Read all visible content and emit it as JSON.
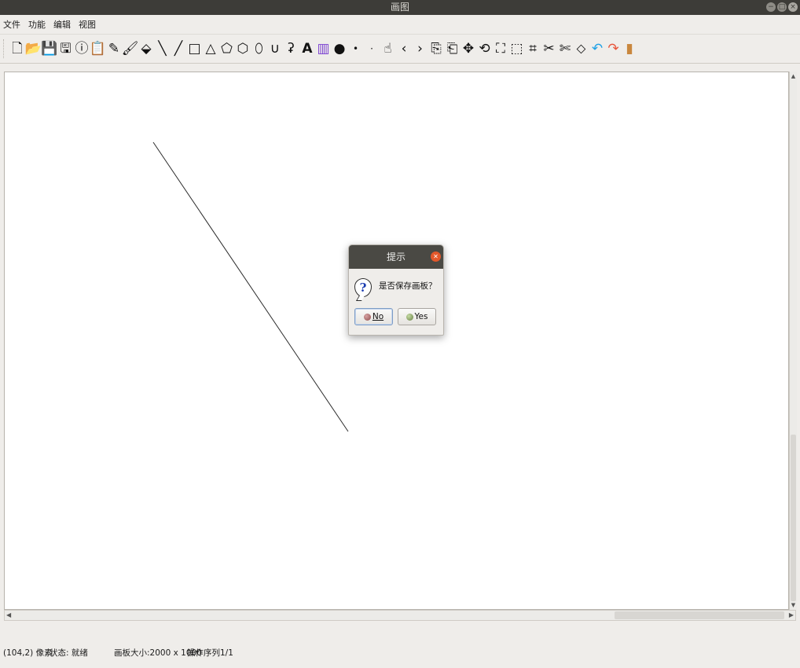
{
  "window": {
    "title": "画图",
    "controls": [
      "−",
      "□",
      "×"
    ]
  },
  "menu": [
    "文件",
    "功能",
    "编辑",
    "视图"
  ],
  "toolbar": {
    "tools": [
      {
        "name": "new-file-icon",
        "glyph": "🗋"
      },
      {
        "name": "open-folder-icon",
        "glyph": "📂"
      },
      {
        "name": "save-icon",
        "glyph": "💾"
      },
      {
        "name": "save-as-icon",
        "glyph": "🖫"
      },
      {
        "name": "info-icon",
        "glyph": "ⓘ"
      },
      {
        "name": "clipboard-icon",
        "glyph": "📋"
      },
      {
        "name": "pencil-icon",
        "glyph": "✎"
      },
      {
        "name": "brush-icon",
        "glyph": "🖌"
      },
      {
        "name": "eraser-icon",
        "glyph": "⬙"
      },
      {
        "name": "backslash-line-icon",
        "glyph": "╲"
      },
      {
        "name": "line-icon",
        "glyph": "╱"
      },
      {
        "name": "rectangle-icon",
        "glyph": "□"
      },
      {
        "name": "triangle-icon",
        "glyph": "△"
      },
      {
        "name": "pentagon-icon",
        "glyph": "⬠"
      },
      {
        "name": "polygon-icon",
        "glyph": "⬡"
      },
      {
        "name": "ellipse-icon",
        "glyph": "⬯"
      },
      {
        "name": "curve-icon",
        "glyph": "∪"
      },
      {
        "name": "freeform-icon",
        "glyph": "ʡ"
      },
      {
        "name": "text-icon",
        "glyph": "A"
      },
      {
        "name": "color-picker-icon",
        "glyph": "▥"
      },
      {
        "name": "brush-size-large-icon",
        "glyph": "●"
      },
      {
        "name": "brush-size-medium-icon",
        "glyph": "•"
      },
      {
        "name": "brush-size-small-icon",
        "glyph": "·"
      },
      {
        "name": "pointer-icon",
        "glyph": "☝"
      },
      {
        "name": "previous-icon",
        "glyph": "‹"
      },
      {
        "name": "next-icon",
        "glyph": "›"
      },
      {
        "name": "copy-icon",
        "glyph": "⎘"
      },
      {
        "name": "paste-icon",
        "glyph": "⎗"
      },
      {
        "name": "move-icon",
        "glyph": "✥"
      },
      {
        "name": "rotate-icon",
        "glyph": "⟲"
      },
      {
        "name": "fullscreen-icon",
        "glyph": "⛶"
      },
      {
        "name": "select-cut-icon",
        "glyph": "⬚"
      },
      {
        "name": "crop-icon",
        "glyph": "⌗"
      },
      {
        "name": "cut-icon",
        "glyph": "✂"
      },
      {
        "name": "cut-alt-icon",
        "glyph": "✄"
      },
      {
        "name": "fill-bucket-icon",
        "glyph": "⬦"
      },
      {
        "name": "undo-icon",
        "glyph": "↶"
      },
      {
        "name": "redo-icon",
        "glyph": "↷"
      },
      {
        "name": "clear-canvas-icon",
        "glyph": "▮"
      }
    ]
  },
  "colors": {
    "undo": "#1ea1e6",
    "redo": "#e8543a",
    "clear": "#c9873e",
    "palette": "#7a3fd1"
  },
  "status": {
    "coords": "(104,2) 像素",
    "state": "状态: 就绪",
    "canvas_size": "画板大小:2000 x 1000",
    "sequence": "操作序列1/1"
  },
  "dialog": {
    "title": "提示",
    "message": "是否保存画板？",
    "no_label": "No",
    "yes_label": "Yes"
  }
}
